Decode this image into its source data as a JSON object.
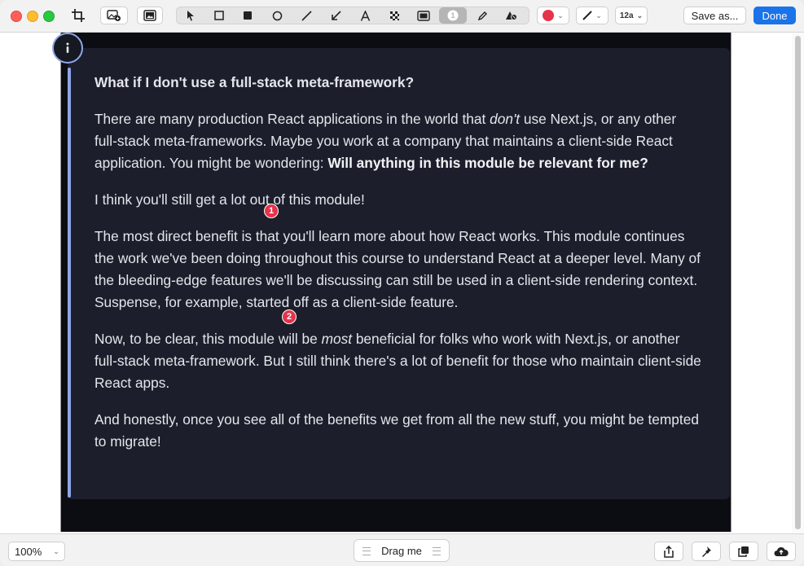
{
  "toolbar": {
    "tools": [
      "pointer-icon",
      "rectangle-outline-icon",
      "rectangle-filled-icon",
      "ellipse-icon",
      "line-icon",
      "arrow-icon",
      "text-icon",
      "pixelate-icon",
      "highlight-icon",
      "counter-icon",
      "pen-icon",
      "eraser-icon"
    ],
    "counter_label": "1",
    "color_swatch": "#e5334b",
    "font_size_label": "12a",
    "save_label": "Save as...",
    "done_label": "Done"
  },
  "content": {
    "heading": "What if I don't use a full-stack meta-framework?",
    "p1_a": "There are many production React applications in the world that ",
    "p1_em": "don't",
    "p1_b": " use Next.js, or any other full-stack meta-frameworks. Maybe you work at a company that maintains a client-side React application. You might be wondering: ",
    "p1_strong": "Will anything in this module be relevant for me?",
    "p2": "I think you'll still get a lot out of this module!",
    "p3": "The most direct benefit is that you'll learn more about how React works. This module continues the work we've been doing throughout this course to understand React at a deeper level. Many of the bleeding-edge features we'll be discussing can still be used in a client-side rendering context. Suspense, for example, started off as a client-side feature.",
    "p4_a": "Now, to be clear, this module will be ",
    "p4_em": "most",
    "p4_b": " beneficial for folks who work with Next.js, or another full-stack meta-framework. But I still think there's a lot of benefit for those who maintain client-side React apps.",
    "p5": "And honestly, once you see all of the benefits we get from all the new stuff, you might be tempted to migrate!"
  },
  "markers": [
    "1",
    "2"
  ],
  "bottom": {
    "zoom": "100%",
    "drag_label": "Drag me"
  },
  "colors": {
    "accent": "#1a73e8",
    "callout_bar": "#8ea6e8",
    "marker": "#e5334b"
  }
}
